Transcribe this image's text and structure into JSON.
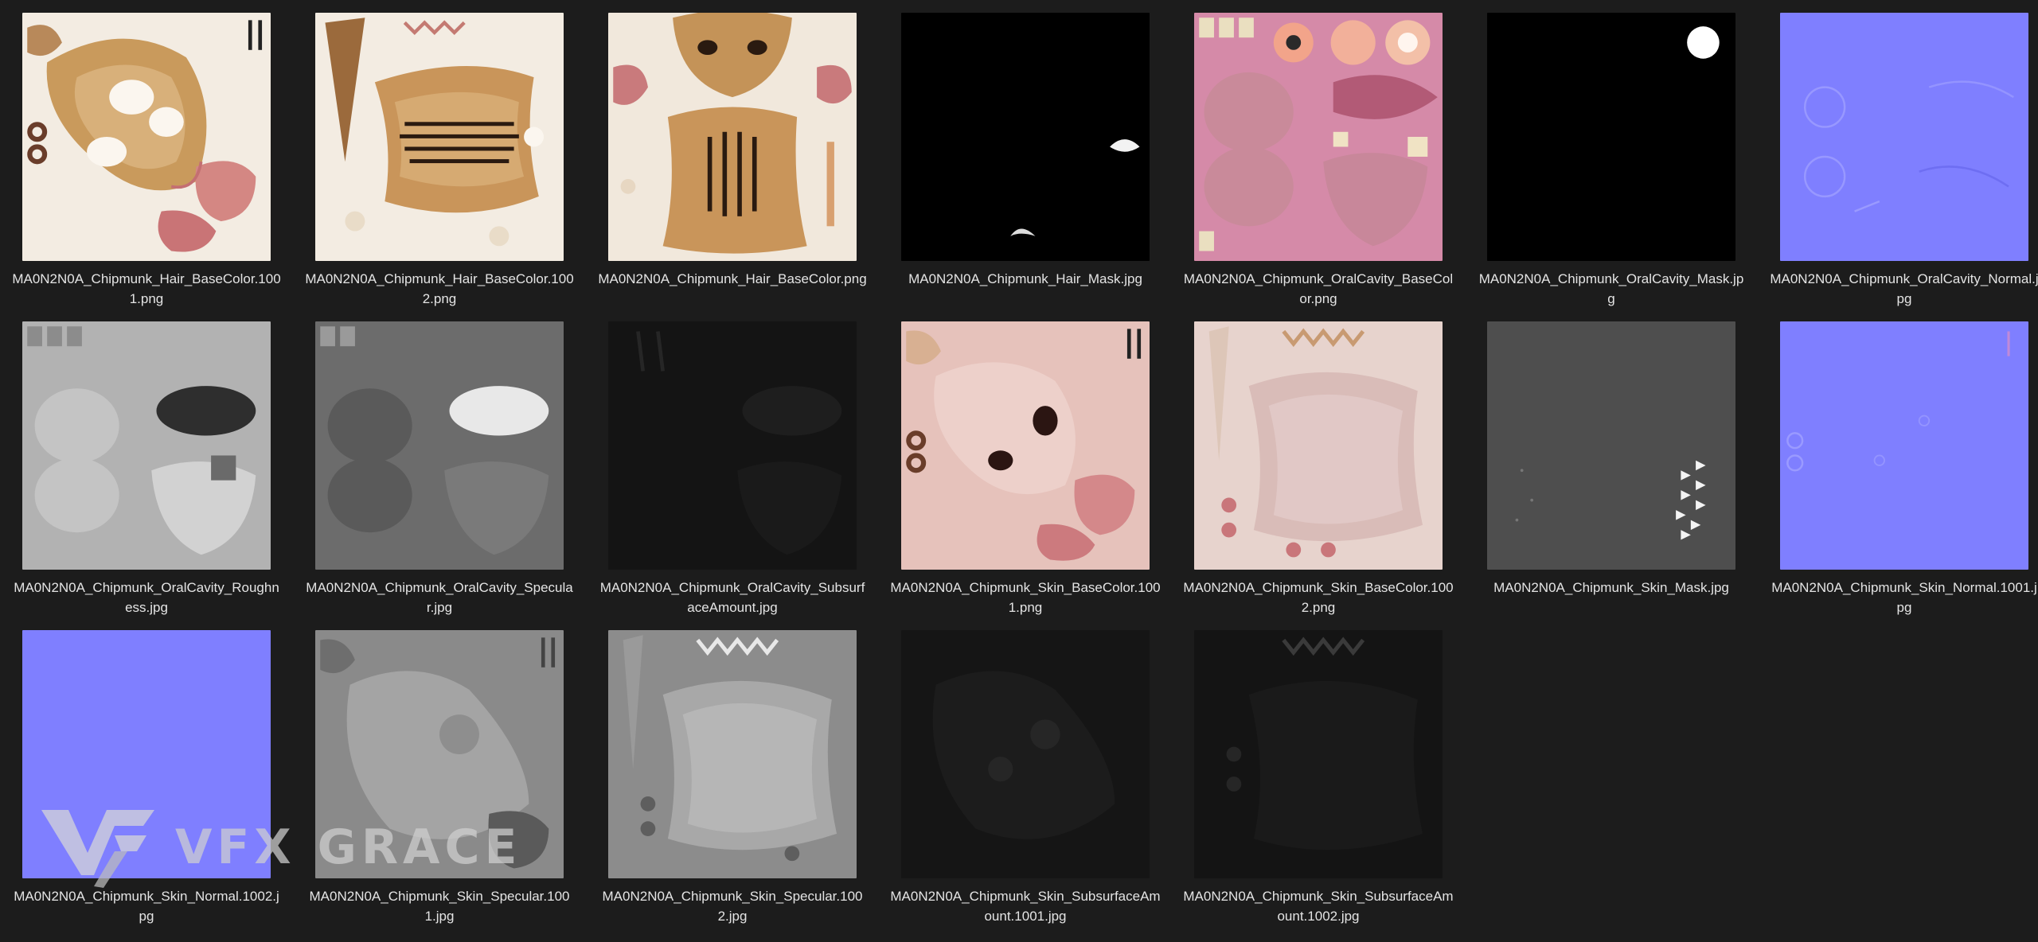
{
  "files": [
    {
      "name": "MA0N2N0A_Chipmunk_Hair_BaseColor.1001.png",
      "thumb": "hair-basecolor-1001"
    },
    {
      "name": "MA0N2N0A_Chipmunk_Hair_BaseColor.1002.png",
      "thumb": "hair-basecolor-1002"
    },
    {
      "name": "MA0N2N0A_Chipmunk_Hair_BaseColor.png",
      "thumb": "hair-basecolor"
    },
    {
      "name": "MA0N2N0A_Chipmunk_Hair_Mask.jpg",
      "thumb": "hair-mask"
    },
    {
      "name": "MA0N2N0A_Chipmunk_OralCavity_BaseColor.png",
      "thumb": "oral-basecolor"
    },
    {
      "name": "MA0N2N0A_Chipmunk_OralCavity_Mask.jpg",
      "thumb": "oral-mask"
    },
    {
      "name": "MA0N2N0A_Chipmunk_OralCavity_Normal.jpg",
      "thumb": "oral-normal"
    },
    {
      "name": "MA0N2N0A_Chipmunk_OralCavity_Roughness.jpg",
      "thumb": "oral-roughness"
    },
    {
      "name": "MA0N2N0A_Chipmunk_OralCavity_Specular.jpg",
      "thumb": "oral-specular"
    },
    {
      "name": "MA0N2N0A_Chipmunk_OralCavity_SubsurfaceAmount.jpg",
      "thumb": "oral-subsurface"
    },
    {
      "name": "MA0N2N0A_Chipmunk_Skin_BaseColor.1001.png",
      "thumb": "skin-basecolor-1001"
    },
    {
      "name": "MA0N2N0A_Chipmunk_Skin_BaseColor.1002.png",
      "thumb": "skin-basecolor-1002"
    },
    {
      "name": "MA0N2N0A_Chipmunk_Skin_Mask.jpg",
      "thumb": "skin-mask"
    },
    {
      "name": "MA0N2N0A_Chipmunk_Skin_Normal.1001.jpg",
      "thumb": "skin-normal-1001"
    },
    {
      "name": "MA0N2N0A_Chipmunk_Skin_Normal.1002.jpg",
      "thumb": "skin-normal-1002"
    },
    {
      "name": "MA0N2N0A_Chipmunk_Skin_Specular.1001.jpg",
      "thumb": "skin-specular-1001"
    },
    {
      "name": "MA0N2N0A_Chipmunk_Skin_Specular.1002.jpg",
      "thumb": "skin-specular-1002"
    },
    {
      "name": "MA0N2N0A_Chipmunk_Skin_SubsurfaceAmount.1001.jpg",
      "thumb": "skin-subsurface-1001"
    },
    {
      "name": "MA0N2N0A_Chipmunk_Skin_SubsurfaceAmount.1002.jpg",
      "thumb": "skin-subsurface-1002"
    }
  ],
  "watermark": {
    "text": "VFX GRACE"
  },
  "colors": {
    "background": "#1c1c1c",
    "normal_blue": "#7f7fff",
    "label": "#e4e4e4"
  }
}
